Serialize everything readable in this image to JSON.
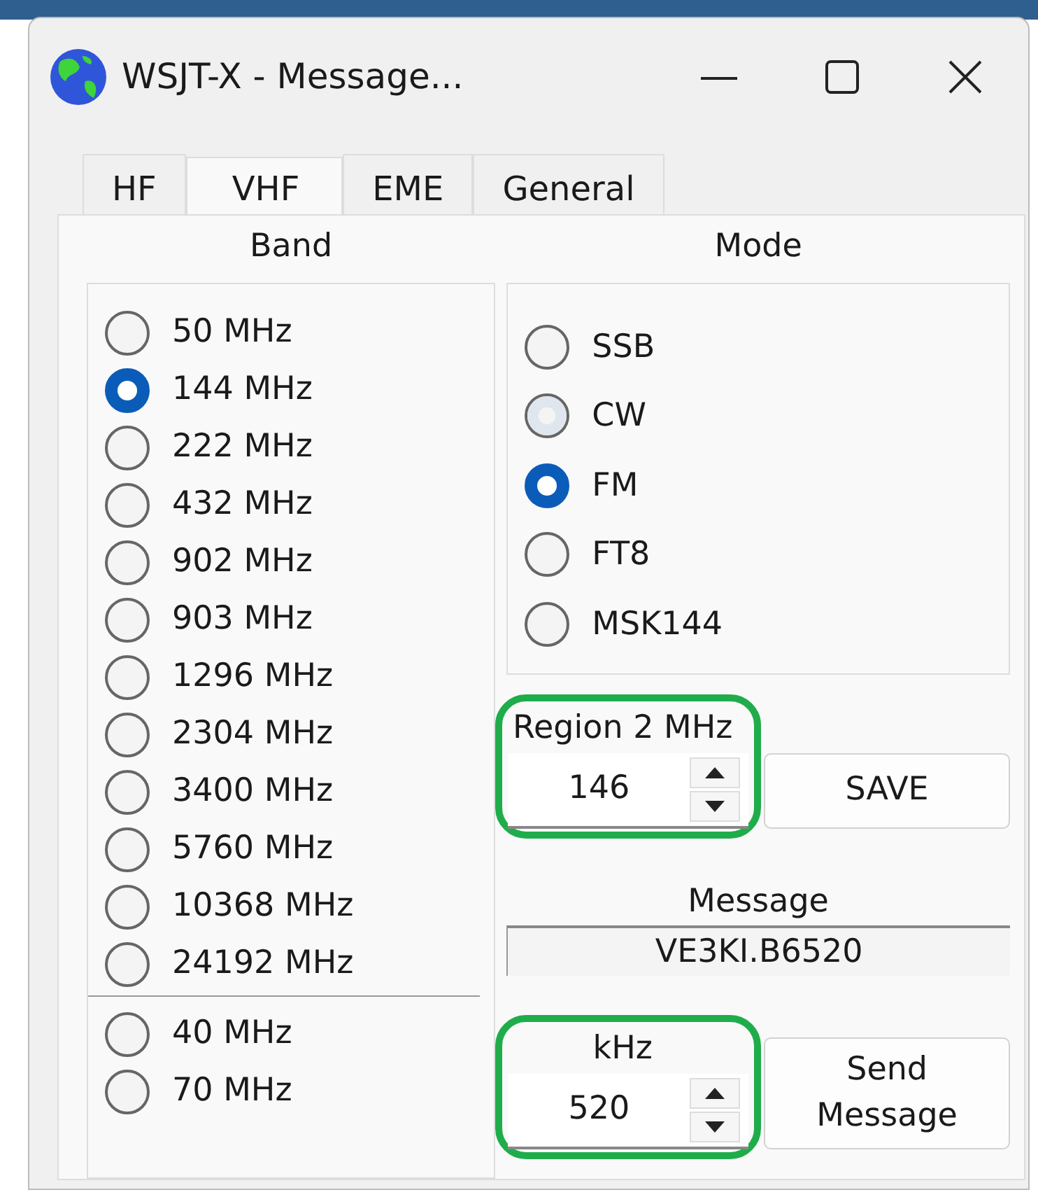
{
  "window": {
    "title": "WSJT-X - Message..."
  },
  "tabs": [
    {
      "label": "HF",
      "selected": false
    },
    {
      "label": "VHF",
      "selected": true
    },
    {
      "label": "EME",
      "selected": false
    },
    {
      "label": "General",
      "selected": false
    }
  ],
  "band": {
    "title": "Band",
    "items": [
      {
        "label": "50 MHz",
        "selected": false
      },
      {
        "label": "144 MHz",
        "selected": true
      },
      {
        "label": "222 MHz",
        "selected": false
      },
      {
        "label": "432 MHz",
        "selected": false
      },
      {
        "label": "902 MHz",
        "selected": false
      },
      {
        "label": "903 MHz",
        "selected": false
      },
      {
        "label": "1296 MHz",
        "selected": false
      },
      {
        "label": "2304 MHz",
        "selected": false
      },
      {
        "label": "3400 MHz",
        "selected": false
      },
      {
        "label": "5760 MHz",
        "selected": false
      },
      {
        "label": "10368 MHz",
        "selected": false
      },
      {
        "label": "24192 MHz",
        "selected": false
      }
    ],
    "extra_items": [
      {
        "label": "40 MHz",
        "selected": false
      },
      {
        "label": "70 MHz",
        "selected": false
      }
    ]
  },
  "mode": {
    "title": "Mode",
    "items": [
      {
        "label": "SSB",
        "selected": false,
        "hovered": false
      },
      {
        "label": "CW",
        "selected": false,
        "hovered": true
      },
      {
        "label": "FM",
        "selected": true,
        "hovered": false
      },
      {
        "label": "FT8",
        "selected": false,
        "hovered": false
      },
      {
        "label": "MSK144",
        "selected": false,
        "hovered": false
      }
    ]
  },
  "region": {
    "label": "Region 2 MHz",
    "value": "146",
    "highlighted": true
  },
  "save_button": "SAVE",
  "message": {
    "label": "Message",
    "value": "VE3KI.B6520"
  },
  "khz": {
    "label": "kHz",
    "value": "520",
    "highlighted": true
  },
  "send_button": "Send Message"
}
